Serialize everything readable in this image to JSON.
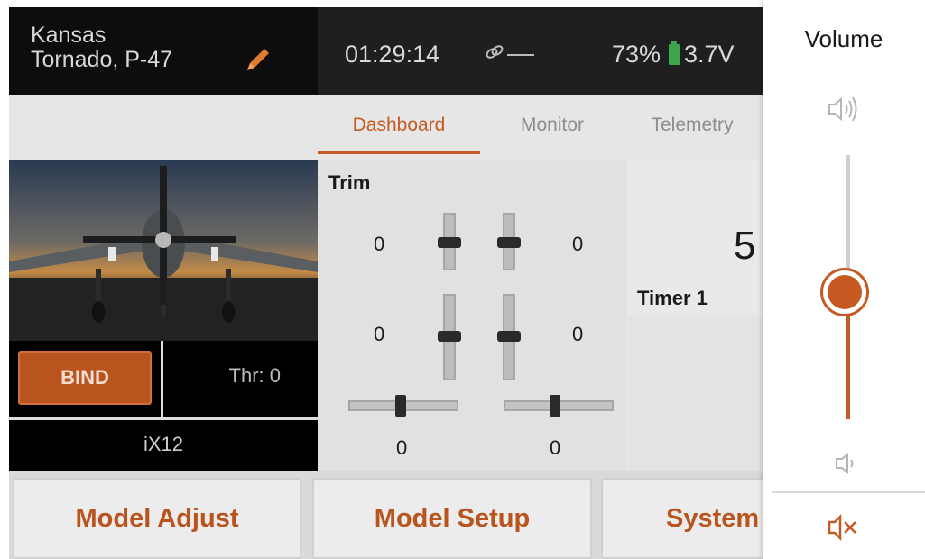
{
  "status_bar": {
    "model_line1": "Kansas",
    "model_line2": "Tornado, P-47",
    "time": "01:29:14",
    "link_status": "——",
    "battery_percent": "73%",
    "voltage": "3.7V",
    "icons": [
      "pencil-icon",
      "link-icon",
      "battery-icon"
    ]
  },
  "tabs": [
    {
      "label": "Dashboard",
      "active": true
    },
    {
      "label": "Monitor",
      "active": false
    },
    {
      "label": "Telemetry",
      "active": false
    }
  ],
  "model_panel": {
    "bind_label": "BIND",
    "throttle_label": "Thr: 0",
    "radio_name": "iX12"
  },
  "trim": {
    "title": "Trim",
    "left_upper_value": "0",
    "right_upper_value": "0",
    "left_lower_value": "0",
    "right_lower_value": "0",
    "bottom_left_value": "0",
    "bottom_right_value": "0"
  },
  "timer": {
    "value_partial": "5",
    "label": "Timer 1"
  },
  "bottom_buttons": {
    "model_adjust": "Model Adjust",
    "model_setup": "Model Setup",
    "system": "System"
  },
  "volume": {
    "title": "Volume",
    "level_fraction": 0.48,
    "icons": [
      "volume-high-icon",
      "volume-low-icon",
      "mute-icon"
    ]
  },
  "colors": {
    "accent": "#c75a22",
    "status_bar_bg": "#1f1f1f",
    "screen_bg": "#e6e6e6",
    "battery": "#3fa34d"
  }
}
